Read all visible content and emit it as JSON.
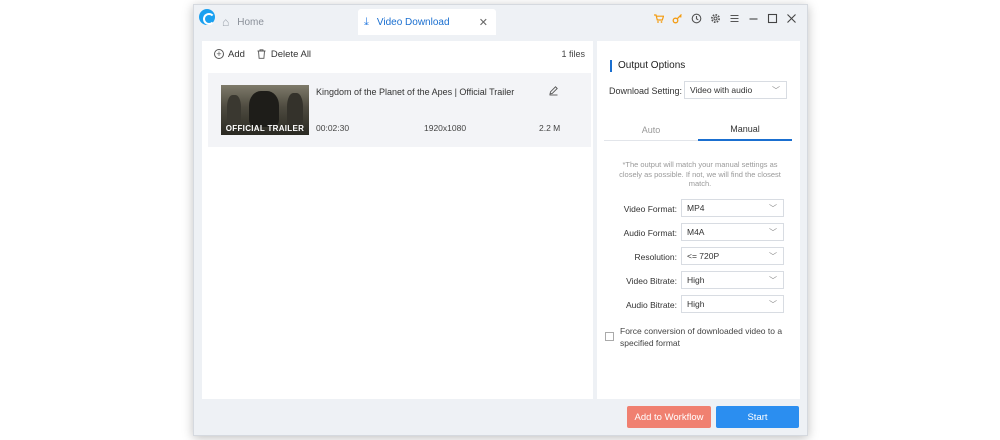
{
  "tabs": {
    "home": "Home",
    "active": "Video Download",
    "close_glyph": "✕"
  },
  "toolbar_icons": [
    "cart-icon",
    "key-icon",
    "history-icon",
    "settings-icon",
    "menu-icon",
    "minimize-icon",
    "maximize-icon",
    "close-icon"
  ],
  "list": {
    "add_label": "Add",
    "delete_all_label": "Delete All",
    "files_count": "1 files",
    "items": [
      {
        "title": "Kingdom of the Planet of the Apes | Official Trailer",
        "thumbnail_text": "OFFICIAL TRAILER",
        "duration": "00:02:30",
        "resolution": "1920x1080",
        "size": "2.2 M"
      }
    ]
  },
  "output": {
    "header": "Output Options",
    "download_setting_label": "Download Setting:",
    "download_setting_value": "Video with audio",
    "mode_tabs": [
      "Auto",
      "Manual"
    ],
    "active_mode": "Manual",
    "note": "*The output will match your manual settings as closely as possible. If not, we will find the closest match.",
    "fields": [
      {
        "label": "Video Format:",
        "value": "MP4"
      },
      {
        "label": "Audio Format:",
        "value": "M4A"
      },
      {
        "label": "Resolution:",
        "value": "<= 720P"
      },
      {
        "label": "Video Bitrate:",
        "value": "High"
      },
      {
        "label": "Audio Bitrate:",
        "value": "High"
      }
    ],
    "force_conversion_label": "Force conversion of downloaded video to a specified format",
    "force_conversion_checked": false
  },
  "buttons": {
    "add_to_workflow": "Add to Workflow",
    "start": "Start"
  },
  "colors": {
    "accent": "#1a6fd0",
    "start_button": "#2b8ef0",
    "workflow_button": "#f08070",
    "toolbar_icon_orange": "#f39c12"
  }
}
